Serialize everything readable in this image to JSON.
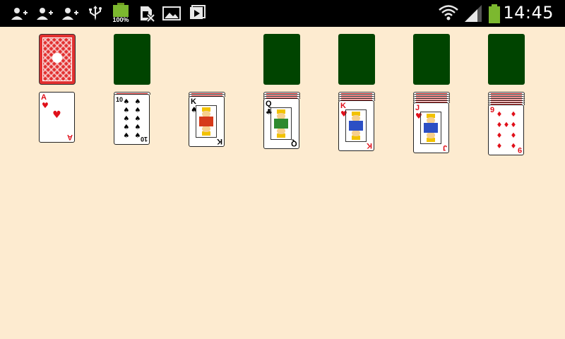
{
  "status_bar": {
    "time": "14:45",
    "battery_text": "100%",
    "icons": [
      "person-add-icon",
      "person-add-icon",
      "person-add-icon",
      "usb-icon",
      "battery-full-icon",
      "no-sim-icon",
      "gallery-icon",
      "media-icon",
      "wifi-icon",
      "signal-icon",
      "battery-icon"
    ]
  },
  "game": {
    "stock": {
      "face_down": true
    },
    "waste": {
      "empty": true
    },
    "foundations": [
      {
        "empty": true
      },
      {
        "empty": true
      },
      {
        "empty": true
      },
      {
        "empty": true
      }
    ],
    "tableau": [
      {
        "hidden": 0,
        "top": {
          "rank": "A",
          "suit": "♥",
          "color": "red"
        }
      },
      {
        "hidden": 1,
        "top": {
          "rank": "10",
          "suit": "♠",
          "color": "black"
        }
      },
      {
        "hidden": 2,
        "top": {
          "rank": "K",
          "suit": "♠",
          "color": "black"
        }
      },
      {
        "hidden": 3,
        "top": {
          "rank": "Q",
          "suit": "♣",
          "color": "black"
        }
      },
      {
        "hidden": 4,
        "top": {
          "rank": "K",
          "suit": "♥",
          "color": "red"
        }
      },
      {
        "hidden": 5,
        "top": {
          "rank": "J",
          "suit": "♥",
          "color": "red"
        }
      },
      {
        "hidden": 6,
        "top": {
          "rank": "9",
          "suit": "♦",
          "color": "red"
        }
      }
    ]
  },
  "colors": {
    "felt": "#fdebd0",
    "slot": "#004400",
    "card_back": "#e23030",
    "red_suit": "#e0101a",
    "black_suit": "#000000"
  }
}
